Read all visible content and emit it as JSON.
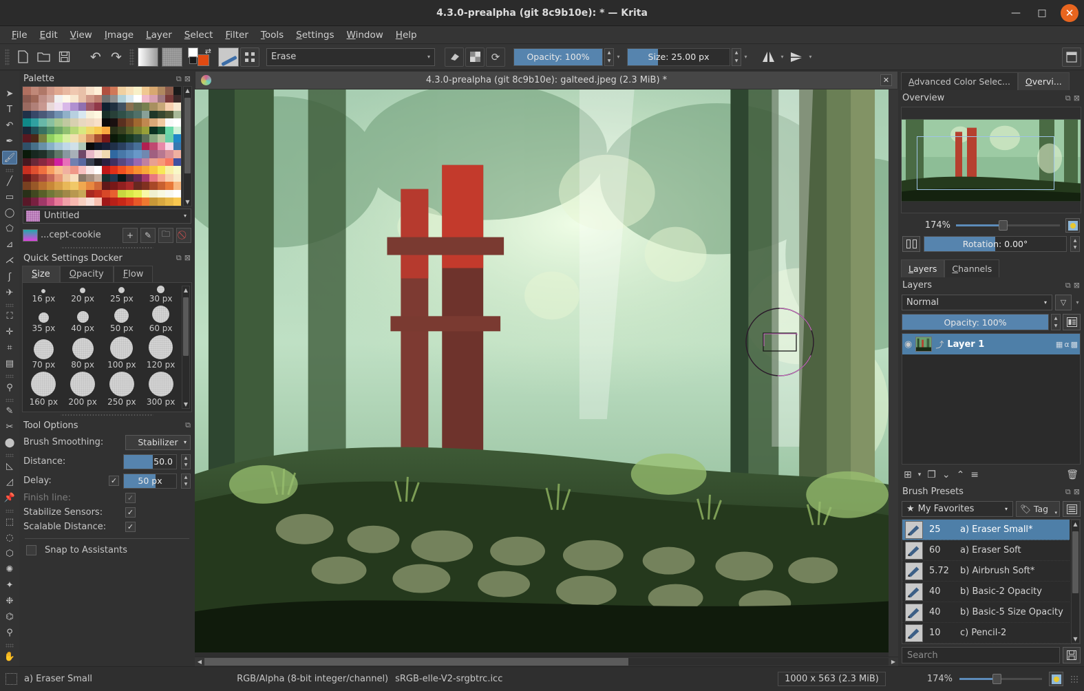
{
  "window": {
    "title": "4.3.0-prealpha (git 8c9b10e):  * — Krita",
    "minimize": "—",
    "maximize": "□",
    "close": "✕"
  },
  "menubar": [
    {
      "label": "File"
    },
    {
      "label": "Edit"
    },
    {
      "label": "View"
    },
    {
      "label": "Image"
    },
    {
      "label": "Layer"
    },
    {
      "label": "Select"
    },
    {
      "label": "Filter"
    },
    {
      "label": "Tools"
    },
    {
      "label": "Settings"
    },
    {
      "label": "Window"
    },
    {
      "label": "Help"
    }
  ],
  "toolbar": {
    "new": "new-file-icon",
    "open": "open-folder-icon",
    "save": "save-icon",
    "undo": "↶",
    "redo": "↷",
    "gradient_swatch": "gradient-swatch",
    "pattern_swatch": "pattern-swatch",
    "brush_preset": "brush-preset-icon",
    "grid_icon": "workspace-icon",
    "blending_mode": "Erase",
    "eraser_toggle": "eraser-icon",
    "alpha_toggle": "alpha-icon",
    "reload_preset": "reload-icon",
    "opacity_label": "Opacity: 100%",
    "opacity_fill_pct": 100,
    "size_label": "Size: 25.00 px",
    "size_fill_pct": 30,
    "mirror_h": "mirror-horizontal-icon",
    "mirror_v": "mirror-vertical-icon",
    "right_icon": "choose-workspace-icon"
  },
  "tools": [
    {
      "name": "select-shapes-tool",
      "glyph": "➤"
    },
    {
      "name": "text-tool",
      "glyph": "T"
    },
    {
      "name": "edit-shapes-tool",
      "glyph": "↶"
    },
    {
      "name": "calligraphy-tool",
      "glyph": "✒"
    },
    {
      "name": "freehand-brush-tool",
      "glyph": "🖌",
      "active": true
    },
    {
      "name": "line-tool",
      "glyph": "╱"
    },
    {
      "name": "rectangle-tool",
      "glyph": "▭"
    },
    {
      "name": "ellipse-tool",
      "glyph": "◯"
    },
    {
      "name": "polygon-tool",
      "glyph": "⬠"
    },
    {
      "name": "polyline-tool",
      "glyph": "⊿"
    },
    {
      "name": "bezier-curve-tool",
      "glyph": "⋌"
    },
    {
      "name": "freehand-path-tool",
      "glyph": "ʃ"
    },
    {
      "name": "dynamic-brush-tool",
      "glyph": "✈"
    },
    {
      "name": "transform-tool",
      "glyph": "⛶"
    },
    {
      "name": "move-tool",
      "glyph": "✛"
    },
    {
      "name": "crop-tool",
      "glyph": "⌗"
    },
    {
      "name": "gradient-tool",
      "glyph": "▤"
    },
    {
      "name": "color-sampler-tool",
      "glyph": "⚲"
    },
    {
      "name": "colorize-mask-tool",
      "glyph": "✎"
    },
    {
      "name": "smart-patch-tool",
      "glyph": "✂"
    },
    {
      "name": "fill-tool",
      "glyph": "⬤"
    },
    {
      "name": "measure-tool",
      "glyph": "◺"
    },
    {
      "name": "reference-images-tool",
      "glyph": "◿"
    },
    {
      "name": "assistant-tool",
      "glyph": "📌"
    },
    {
      "name": "rectangular-selection-tool",
      "glyph": "⬚"
    },
    {
      "name": "elliptical-selection-tool",
      "glyph": "◌"
    },
    {
      "name": "polygonal-selection-tool",
      "glyph": "⬡"
    },
    {
      "name": "freehand-selection-tool",
      "glyph": "✺"
    },
    {
      "name": "contiguous-selection-tool",
      "glyph": "✦"
    },
    {
      "name": "similar-color-selection-tool",
      "glyph": "❉"
    },
    {
      "name": "bezier-selection-tool",
      "glyph": "⌬"
    },
    {
      "name": "zoom-tool",
      "glyph": "⚲"
    },
    {
      "name": "pan-tool",
      "glyph": "✋"
    }
  ],
  "palette_docker": {
    "title": "Palette",
    "float_icon": "float-docker-icon",
    "close_icon": "close-docker-icon",
    "selected_group": "Untitled",
    "palette_name": "...cept-cookie",
    "add_button": "+",
    "edit_button": "✎",
    "folder_button": "🗀",
    "delete_button": "⃠"
  },
  "quick_settings": {
    "title": "Quick Settings Docker",
    "tabs": [
      {
        "label": "Size",
        "active": true
      },
      {
        "label": "Opacity",
        "active": false
      },
      {
        "label": "Flow",
        "active": false
      }
    ],
    "sizes": [
      {
        "label": "16 px",
        "dot": 6
      },
      {
        "label": "20 px",
        "dot": 8
      },
      {
        "label": "25 px",
        "dot": 9
      },
      {
        "label": "30 px",
        "dot": 11
      },
      {
        "label": "35 px",
        "dot": 15
      },
      {
        "label": "40 px",
        "dot": 17
      },
      {
        "label": "50 px",
        "dot": 21
      },
      {
        "label": "60 px",
        "dot": 25
      },
      {
        "label": "70 px",
        "dot": 29
      },
      {
        "label": "80 px",
        "dot": 31
      },
      {
        "label": "100 px",
        "dot": 33
      },
      {
        "label": "120 px",
        "dot": 35
      },
      {
        "label": "160 px",
        "dot": 36
      },
      {
        "label": "200 px",
        "dot": 36
      },
      {
        "label": "250 px",
        "dot": 36
      },
      {
        "label": "300 px",
        "dot": 36
      }
    ]
  },
  "tool_options": {
    "title": "Tool Options",
    "brush_smoothing_label": "Brush Smoothing:",
    "brush_smoothing_value": "Stabilizer",
    "distance_label": "Distance:",
    "distance_value": "50.0",
    "distance_fill_pct": 55,
    "delay_label": "Delay:",
    "delay_checked": "✓",
    "delay_value": "50",
    "delay_unit": "px",
    "delay_fill_pct": 60,
    "finish_line_label": "Finish line:",
    "finish_line_checked": "✓",
    "stabilize_sensors_label": "Stabilize Sensors:",
    "stabilize_sensors_checked": "✓",
    "scalable_distance_label": "Scalable Distance:",
    "scalable_distance_checked": "✓",
    "snap_to_assistants_label": "Snap to Assistants",
    "snap_to_assistants_checked": ""
  },
  "canvas": {
    "title": "4.3.0-prealpha (git 8c9b10e): galteed.jpeg (2.3 MiB) *",
    "close": "✕",
    "brush_cursor": {
      "circle_diameter": 100,
      "rect_w": 48,
      "rect_h": 26
    }
  },
  "right_panel": {
    "tabs": [
      {
        "label": "Advanced Color Selec...",
        "active": false
      },
      {
        "label": "Overvi...",
        "active": true
      }
    ],
    "overview_title": "Overview",
    "zoom_pct": "174%",
    "zoom_slider_pct": 45,
    "rotation_label": "Rotation: 0.00°",
    "rotation_fill_pct": 50,
    "mirror_icon": "mirror-view-icon",
    "reset_icon": "reset-zoom-icon"
  },
  "layers_panel": {
    "tabs": [
      {
        "label": "Layers",
        "active": true
      },
      {
        "label": "Channels",
        "active": false
      }
    ],
    "title": "Layers",
    "blend_mode": "Normal",
    "filter_icon": "filter-icon",
    "opacity_label": "Opacity:  100%",
    "opacity_fill_pct": 100,
    "properties_icon": "layer-properties-icon",
    "layers": [
      {
        "name": "Layer 1",
        "visible": "👁",
        "selected": true
      }
    ],
    "toolbar": [
      {
        "name": "add-layer-button",
        "glyph": "⊞"
      },
      {
        "name": "add-layer-dropdown",
        "glyph": "▾"
      },
      {
        "name": "duplicate-layer-button",
        "glyph": "❐"
      },
      {
        "name": "move-layer-down-button",
        "glyph": "⌄"
      },
      {
        "name": "move-layer-up-button",
        "glyph": "⌃"
      },
      {
        "name": "layer-properties-button",
        "glyph": "≡"
      },
      {
        "name": "delete-layer-button",
        "glyph": "🗑"
      }
    ]
  },
  "brush_presets": {
    "title": "Brush Presets",
    "tag_selector": "My Favorites",
    "star_icon": "★",
    "tag_button": "Tag",
    "list_view_icon": "list-view-icon",
    "presets": [
      {
        "size": "25",
        "name": "a) Eraser Small*",
        "selected": true
      },
      {
        "size": "60",
        "name": "a) Eraser Soft",
        "selected": false
      },
      {
        "size": "5.72",
        "name": "b) Airbrush Soft*",
        "selected": false
      },
      {
        "size": "40",
        "name": "b) Basic-2 Opacity",
        "selected": false
      },
      {
        "size": "40",
        "name": "b) Basic-5 Size Opacity",
        "selected": false
      },
      {
        "size": "10",
        "name": "c) Pencil-2",
        "selected": false
      }
    ],
    "search_placeholder": "Search",
    "save_icon": "save-preset-icon"
  },
  "statusbar": {
    "selection_icon": "selection-mask-icon",
    "brush_name": "a) Eraser Small",
    "color_model": "RGB/Alpha (8-bit integer/channel)",
    "color_profile": "sRGB-elle-V2-srgbtrc.icc",
    "document_size": "1000 x 563 (2.3 MiB)",
    "zoom_pct": "174%",
    "zoom_slider_pct": 45
  },
  "colors": {
    "accent_blue": "#5684ae",
    "selection_blue": "#4e7fa8",
    "close_orange": "#e8651f",
    "bg_dark": "#313131",
    "panel": "#353535"
  },
  "palette_swatches": [
    "#b07060",
    "#c08878",
    "#b07868",
    "#d09888",
    "#e0a890",
    "#e8b8a0",
    "#f0c8b0",
    "#e8c0a8",
    "#f8e0c8",
    "#fff0d8",
    "#b05040",
    "#d07858",
    "#f0d0a0",
    "#f8e0b8",
    "#f8f0c8",
    "#f0c890",
    "#d8a870",
    "#b08860",
    "#8b5a4a",
    "#1a1a1a",
    "#8b5a50",
    "#a06858",
    "#c09088",
    "#d0a8a0",
    "#f0f0f0",
    "#fff8e8",
    "#f8e8d0",
    "#e8c0a8",
    "#d09888",
    "#c08070",
    "#707070",
    "#909090",
    "#b0d0d8",
    "#d8e8f0",
    "#ffffff",
    "#f0b8c8",
    "#d8a0b0",
    "#a07880",
    "#7a3a3a",
    "#3a2a2a",
    "#9a6a60",
    "#b08078",
    "#c89890",
    "#e8d8d8",
    "#f0e0f0",
    "#d8b8e8",
    "#b090d0",
    "#9070b0",
    "#a05868",
    "#903848",
    "#102030",
    "#203040",
    "#405060",
    "#8a7050",
    "#687050",
    "#788050",
    "#a89060",
    "#c8a878",
    "#f8d0b0",
    "#f8e8d0",
    "#203048",
    "#384868",
    "#4a5a78",
    "#5a7090",
    "#7090b0",
    "#90b0c8",
    "#b8d0e0",
    "#d8e8f0",
    "#f8f0d8",
    "#fff8e0",
    "#183028",
    "#284038",
    "#305048",
    "#406058",
    "#507068",
    "#88a098",
    "#203828",
    "#384830",
    "#505838",
    "#a8b898",
    "#108888",
    "#30a0a0",
    "#68b8a8",
    "#88c0a0",
    "#a8c890",
    "#c0c8a0",
    "#d8d0b0",
    "#e8d8c0",
    "#f0d8c0",
    "#f8e0c8",
    "#0a0a0a",
    "#1a1010",
    "#5a3020",
    "#7a4828",
    "#a06830",
    "#c08850",
    "#d8a878",
    "#f0c8a0",
    "#f8f8f8",
    "#ffffff",
    "#182838",
    "#205058",
    "#387060",
    "#509068",
    "#70a868",
    "#90c070",
    "#b8d878",
    "#d8e880",
    "#f0d868",
    "#f8c850",
    "#f8a840",
    "#283018",
    "#384020",
    "#586028",
    "#788030",
    "#98a038",
    "#0a3020",
    "#185838",
    "#68d8a8",
    "#d0f0d8",
    "#581820",
    "#4a2818",
    "#788040",
    "#90d060",
    "#b0e878",
    "#d8f0a0",
    "#f0e0b0",
    "#f0c890",
    "#d89060",
    "#a85030",
    "#781818",
    "#0a1808",
    "#102810",
    "#183820",
    "#284838",
    "#5a7058",
    "#88a880",
    "#b8c8a0",
    "#68d0a8",
    "#2088c8",
    "#305068",
    "#487088",
    "#6890a8",
    "#88b0c8",
    "#a8c8d8",
    "#c0d8e8",
    "#d0e0e8",
    "#b0c8b8",
    "#0a0a0a",
    "#101828",
    "#182038",
    "#203048",
    "#2a4060",
    "#3a5880",
    "#487098",
    "#b02050",
    "#c04870",
    "#e888a8",
    "#f8d8e8",
    "#3878b0",
    "#0a1a0a",
    "#182820",
    "#203028",
    "#385048",
    "#607868",
    "#8898a0",
    "#a8b0b8",
    "#704868",
    "#e8b8c8",
    "#f8e0d8",
    "#f0d8b0",
    "#3068a0",
    "#4878a8",
    "#5888b8",
    "#6898c8",
    "#7088b0",
    "#a06080",
    "#b87890",
    "#d89098",
    "#f0b0a0",
    "#481820",
    "#6a2838",
    "#882840",
    "#a82850",
    "#d020a0",
    "#e870b8",
    "#7080b0",
    "#5868a0",
    "#384050",
    "#181820",
    "#2a2040",
    "#403060",
    "#584880",
    "#6858a0",
    "#9868b0",
    "#c080a0",
    "#e8a090",
    "#f89878",
    "#f87860",
    "#4050a0",
    "#c83020",
    "#e05030",
    "#f07040",
    "#f8a060",
    "#f8c090",
    "#f0b0a0",
    "#f09888",
    "#f8c0c0",
    "#f8e8e8",
    "#ffffff",
    "#c01818",
    "#e03018",
    "#f05020",
    "#f87028",
    "#f89030",
    "#f8a838",
    "#f8c840",
    "#f8e858",
    "#f8f0a8",
    "#f8f8c8",
    "#601818",
    "#8a3028",
    "#a84840",
    "#c86858",
    "#e89878",
    "#f0c8a0",
    "#f8e0c0",
    "#8a7868",
    "#a89080",
    "#c8b0a0",
    "#183030",
    "#203850",
    "#0a1818",
    "#402838",
    "#682850",
    "#a83868",
    "#e87880",
    "#f8a890",
    "#f8d0b0",
    "#f8e8c8",
    "#784020",
    "#985828",
    "#b87030",
    "#c88838",
    "#d8a048",
    "#e8b858",
    "#f0c868",
    "#f0a850",
    "#e88840",
    "#d06838",
    "#601818",
    "#781818",
    "#902020",
    "#a82828",
    "#682820",
    "#803020",
    "#a84828",
    "#c86030",
    "#e87838",
    "#f8b880",
    "#283018",
    "#404820",
    "#586028",
    "#707838",
    "#888040",
    "#a08848",
    "#b89850",
    "#c8a858",
    "#a82820",
    "#c03020",
    "#d84828",
    "#e86030",
    "#c8d840",
    "#d8e848",
    "#e8f058",
    "#f8f8a8",
    "#f0f0d0",
    "#f8f8e0",
    "#f8f8f0",
    "#ffffff",
    "#581828",
    "#782040",
    "#a03868",
    "#c85080",
    "#e87898",
    "#f0a0a8",
    "#f8b8b0",
    "#f8d0c0",
    "#f8e0d8",
    "#f8c0b0",
    "#a01818",
    "#b82018",
    "#c82818",
    "#d83820",
    "#e85828",
    "#f07830",
    "#c89838",
    "#d8a840",
    "#e8b848",
    "#f8c850"
  ]
}
